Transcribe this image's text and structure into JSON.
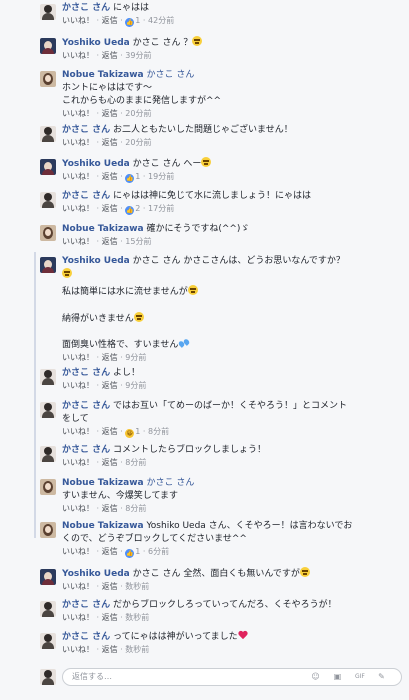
{
  "labels": {
    "like": "いいね！",
    "reply": "返信",
    "sep": " · "
  },
  "comments": [
    {
      "author": "かさこ さん",
      "lines": [
        "にゃはは"
      ],
      "reaction": "like",
      "count": "1",
      "time": "42分前"
    },
    {
      "author": "Yoshiko Ueda",
      "lines": [
        "かさこ さん ？"
      ],
      "emoji": "grin",
      "time": "39分前"
    },
    {
      "author": "Nobue Takizawa",
      "lines": [
        "かさこ さん",
        "ホントにゃははです〜",
        "これからも心のままに発信しますが^^"
      ],
      "time": "20分前"
    },
    {
      "author": "かさこ さん",
      "lines": [
        "お二人ともたいした問題じゃございません！"
      ],
      "time": "20分前"
    },
    {
      "author": "Yoshiko Ueda",
      "lines": [
        "かさこ さん へー"
      ],
      "emoji": "meh",
      "reaction": "like",
      "count": "1",
      "time": "19分前"
    },
    {
      "author": "かさこ さん",
      "lines": [
        "にゃはは神に免じて水に流しましょう！にゃはは"
      ],
      "reaction": "like",
      "count": "2",
      "time": "17分前"
    },
    {
      "author": "Nobue Takizawa",
      "lines": [
        "確かにそうですね(^^)ゞ"
      ],
      "time": "15分前"
    },
    {
      "author": "Yoshiko Ueda",
      "lines": [
        "かさこ さん かさこさんは、どうお思いなんですか？",
        "",
        "私は簡単には水に流せませんが",
        "",
        "納得がいきません",
        "",
        "面倒臭い性格で、すいません"
      ],
      "time": "9分前"
    },
    {
      "author": "かさこ さん",
      "lines": [
        "よし！"
      ],
      "time": "9分前"
    },
    {
      "author": "かさこ さん",
      "lines": [
        "ではお互い「てめーのばーか！くそやろう！」とコメント",
        "をして"
      ],
      "reaction": "haha",
      "count": "1",
      "time": "8分前"
    },
    {
      "author": "かさこ さん",
      "lines": [
        "コメントしたらブロックしましょう！"
      ],
      "time": "8分前"
    },
    {
      "author": "Nobue Takizawa",
      "lines": [
        "かさこ さん",
        "すいません、今爆笑してます"
      ],
      "time": "8分前"
    },
    {
      "author": "Nobue Takizawa",
      "lines": [
        "Yoshiko Ueda さん、くそやろー！は言わないでお",
        "くので、どうぞブロックしてくださいませ^^"
      ],
      "reaction": "like",
      "count": "1",
      "time": "6分前"
    },
    {
      "author": "Yoshiko Ueda",
      "lines": [
        "かさこ さん 全然、面白くも無いんですが"
      ],
      "time": "数秒前"
    },
    {
      "author": "かさこ さん",
      "lines": [
        "だからブロックしろっていってんだろ、くそやろうが！"
      ],
      "time": "数秒前"
    },
    {
      "author": "かさこ さん",
      "lines": [
        "ってにゃはは神がいってました"
      ],
      "time": "数秒前"
    }
  ],
  "reply_box": {
    "placeholder": "返信する…",
    "icons": [
      "emoji-icon",
      "camera-icon",
      "gif-icon",
      "sticker-icon"
    ]
  }
}
